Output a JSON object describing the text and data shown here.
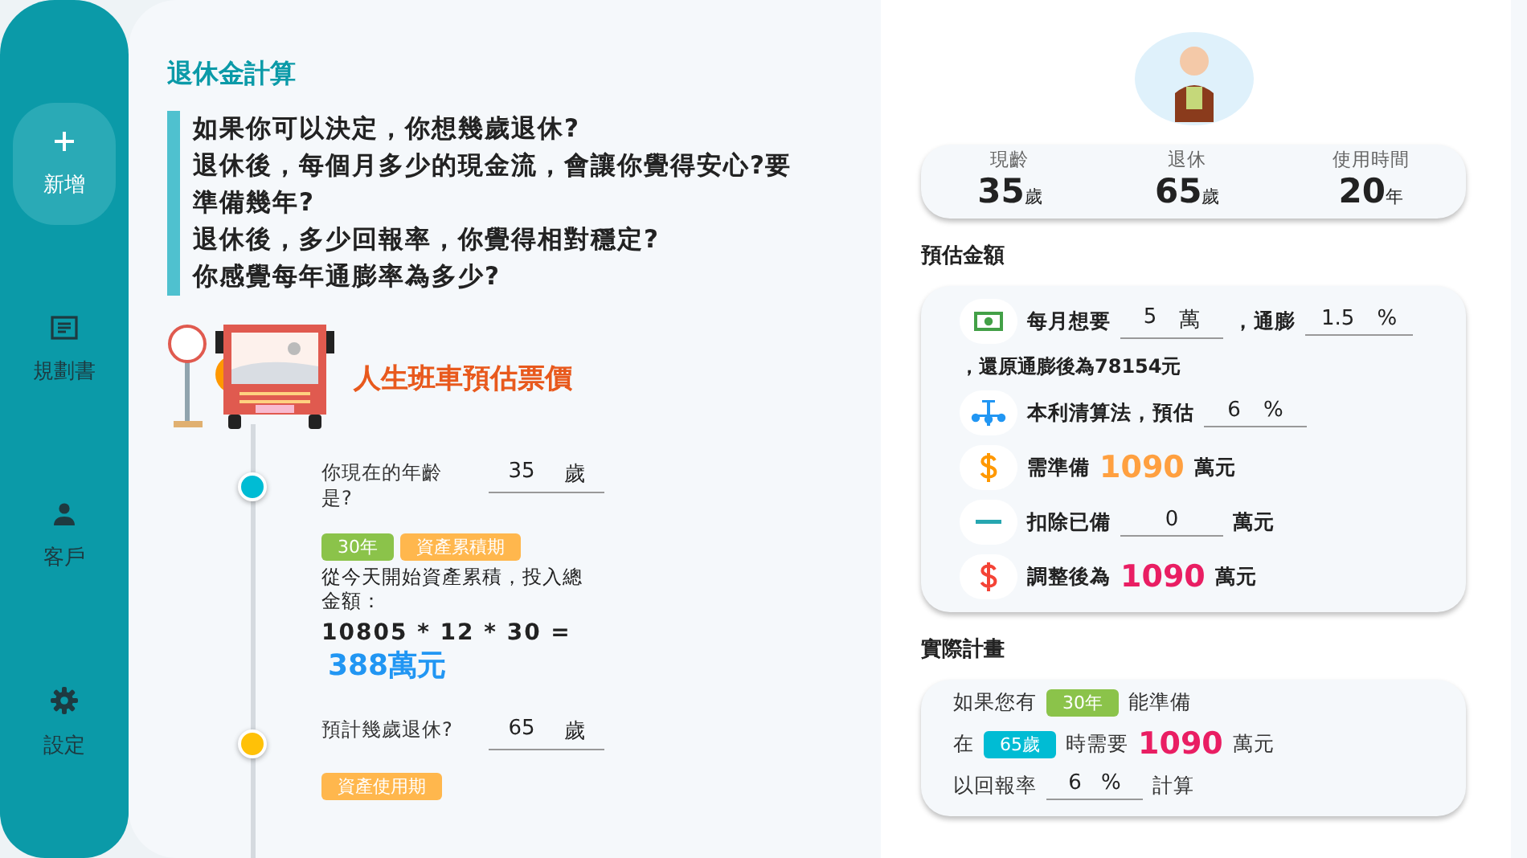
{
  "sidebar": {
    "items": [
      {
        "label": "新增",
        "selected": true
      },
      {
        "label": "規劃書",
        "selected": false
      },
      {
        "label": "客戶",
        "selected": false
      },
      {
        "label": "設定",
        "selected": false
      }
    ]
  },
  "page_title": "退休金計算",
  "questions": [
    "如果你可以決定，你想幾歲退休?",
    "退休後，每個月多少的現金流，會讓你覺得安心?要準備幾年?",
    "退休後，多少回報率，你覺得相對穩定?",
    "你感覺每年通膨率為多少?"
  ],
  "bus_heading": "人生班車預估票價",
  "timeline": [
    {
      "kind": "input",
      "color": "#00bcd4",
      "label": "你現在的年齡是?",
      "value": "35",
      "unit": "歲"
    },
    {
      "kind": "phase",
      "tags": [
        {
          "text": "30年",
          "color": "#8bc34a"
        },
        {
          "text": "資產累積期",
          "color": "#ffb74d"
        }
      ],
      "desc": "從今天開始資產累積，投入總金額：",
      "formula": "10805 * 12 * 30 =",
      "result": "388萬元"
    },
    {
      "kind": "input",
      "color": "#ffc107",
      "label": "預計幾歲退休?",
      "value": "65",
      "unit": "歲"
    },
    {
      "kind": "phase",
      "tags": [
        {
          "text": "資產使用期",
          "color": "#ffb74d"
        }
      ]
    }
  ],
  "summary": [
    {
      "label": "現齡",
      "value": "35",
      "unit": "歲"
    },
    {
      "label": "退休",
      "value": "65",
      "unit": "歲"
    },
    {
      "label": "使用時間",
      "value": "20",
      "unit": "年"
    }
  ],
  "estimate": {
    "title": "預估金額",
    "rows": [
      {
        "kind": "row",
        "color": "#43a047",
        "segments": [
          {
            "kind": "text",
            "text": "每月想要"
          },
          {
            "kind": "field",
            "value": "5",
            "unit": "萬"
          },
          {
            "kind": "text",
            "text": "，通膨"
          },
          {
            "kind": "field",
            "value": "1.5",
            "unit": "%"
          }
        ]
      },
      {
        "kind": "note",
        "text": "，還原通膨後為78154元"
      },
      {
        "kind": "row",
        "color": "#2196f3",
        "segments": [
          {
            "kind": "text",
            "text": "本利清算法，預估"
          },
          {
            "kind": "field",
            "value": "6",
            "unit": "%"
          }
        ]
      },
      {
        "kind": "row",
        "color": "#ff9800",
        "segments": [
          {
            "kind": "text",
            "text": "需準備"
          },
          {
            "kind": "amount",
            "text": "1090",
            "color": "#ffa040"
          },
          {
            "kind": "text",
            "text": "萬元"
          }
        ]
      },
      {
        "kind": "row",
        "color": "#26a6b0",
        "segments": [
          {
            "kind": "text",
            "text": "扣除已備"
          },
          {
            "kind": "field",
            "value": "0"
          },
          {
            "kind": "text",
            "text": "萬元"
          }
        ]
      },
      {
        "kind": "row",
        "color": "#f44336",
        "segments": [
          {
            "kind": "text",
            "text": "調整後為"
          },
          {
            "kind": "amount",
            "text": "1090",
            "color": "#e91e63"
          },
          {
            "kind": "text",
            "text": "萬元"
          }
        ]
      }
    ]
  },
  "plan": {
    "title": "實際計畫",
    "lines": [
      [
        {
          "kind": "text",
          "text": "如果您有"
        },
        {
          "kind": "tag",
          "text": "30年",
          "color": "#8bc34a"
        },
        {
          "kind": "text",
          "text": "能準備"
        }
      ],
      [
        {
          "kind": "text",
          "text": "在"
        },
        {
          "kind": "tag",
          "text": "65歲",
          "color": "#00bcd4"
        },
        {
          "kind": "text",
          "text": "時需要"
        },
        {
          "kind": "amount",
          "text": "1090",
          "color": "#e91e63"
        },
        {
          "kind": "text",
          "text": "萬元"
        }
      ],
      [
        {
          "kind": "text",
          "text": "以回報率"
        },
        {
          "kind": "field",
          "value": "6",
          "unit": "%"
        },
        {
          "kind": "text",
          "text": "計算"
        }
      ]
    ]
  }
}
